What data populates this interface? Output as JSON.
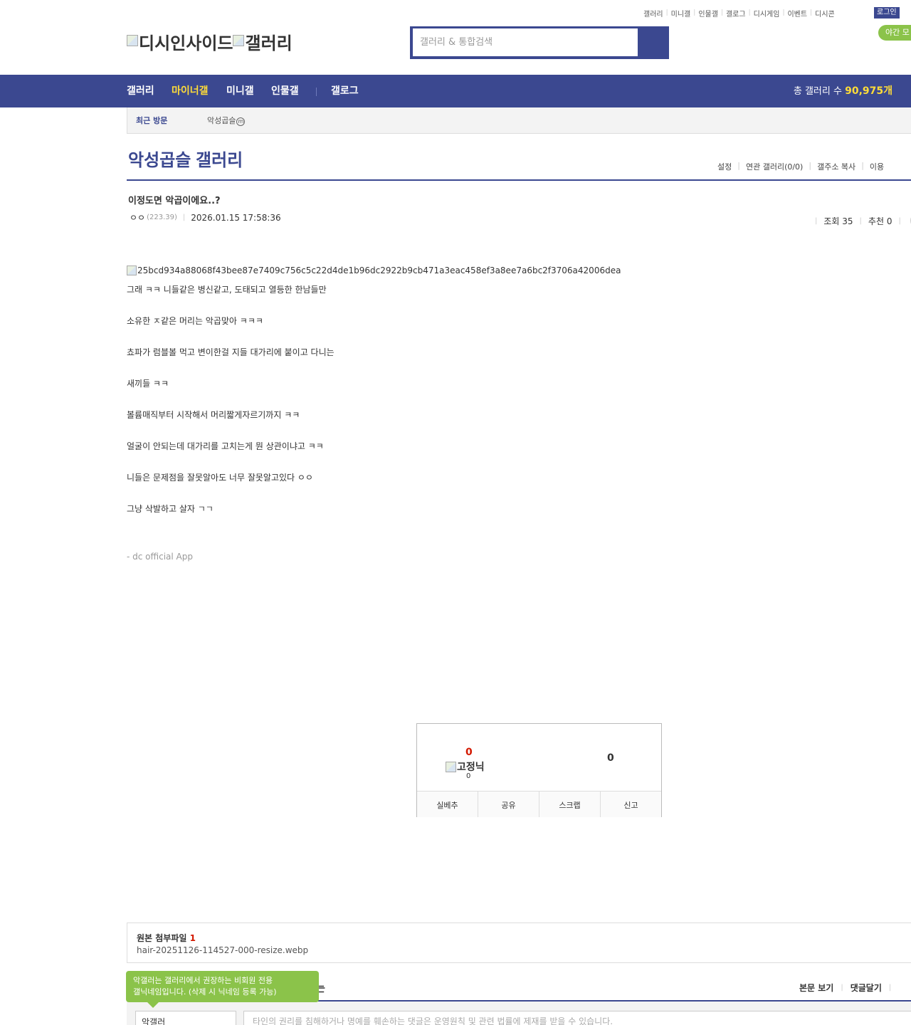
{
  "util_links": [
    "갤러리",
    "미니갤",
    "인물갤",
    "갤로그",
    "디시게임",
    "이벤트",
    "디시콘"
  ],
  "login_label": "로그인",
  "night_mode_label": "야간 모",
  "logo": {
    "site_alt": "디시인사이드",
    "gallery_alt": "갤러리"
  },
  "search": {
    "placeholder": "갤러리 & 통합검색"
  },
  "nav": {
    "items": [
      "갤러리",
      "마이너갤",
      "미니갤",
      "인물갤",
      "갤로그"
    ],
    "active_index": 1,
    "total_label": "총 갤러리 수",
    "total_count": "90,975개"
  },
  "recent": {
    "title": "최근 방문",
    "item": "악성곱슬",
    "item_badge": "m"
  },
  "gallery": {
    "title": "악성곱슬 갤러리",
    "tools": [
      "설정",
      "연관 갤러리(0/0)",
      "갤주소 복사",
      "이용"
    ]
  },
  "post": {
    "title": "이정도면 악곱이에요..?",
    "author": "ㅇㅇ",
    "ip": "(223.39)",
    "date": "2026.01.15 17:58:36",
    "views_label": "조회 35",
    "recommend_label": "추천 0",
    "image_alt": "25bcd934a88068f43bee87e7409c756c5c22d4de1b96dc2922b9cb471a3eac458ef3a8ee7a6bc2f3706a42006dea",
    "lines": [
      "그래 ㅋㅋ 니들같은 병신같고, 도태되고 열등한 한남들만",
      "소유한 ㅈ같은 머리는 악곱맞아 ㅋㅋㅋ",
      "쵸파가 럼블볼 먹고 변이한걸 지들 대가리에 붙이고 다니는",
      "새끼들 ㅋㅋ",
      "볼륨매직부터 시작해서 머리짧게자르기까지 ㅋㅋ",
      "얼굴이 안되는데 대가리를 고치는게 뭔 상관이냐고 ㅋㅋ",
      "니들은 문제점을 잘못알아도 너무 잘못알고있다 ㅇㅇ",
      "그냥 삭발하고 살자 ㄱㄱ"
    ],
    "app_signature": "- dc official App"
  },
  "recommend": {
    "up_count": "0",
    "fixed_nick_alt": "고정닉",
    "fixed_count": "0",
    "down_count": "0",
    "buttons": [
      "실베추",
      "공유",
      "스크랩",
      "신고"
    ]
  },
  "attachments": {
    "title": "원본 첨부파일",
    "count": "1",
    "file": "hair-20251126-114527-000-resize.webp"
  },
  "tooltip": {
    "line1": "악갤러는 갤러리에서 권장하는 비회원 전용",
    "line2": "갤닉네임입니다. (삭제 시 닉네임 등록 가능)"
  },
  "comments": {
    "header_fragment": "는",
    "links": [
      "본문 보기",
      "댓글달기"
    ],
    "nickname_value": "악갤러",
    "input_placeholder": "타인의 권리를 침해하거나 명예를 훼손하는 댓글은 운영원칙 및 관련 법률에 제재를 받을 수 있습니다."
  },
  "colors": {
    "brand": "#3b4890",
    "highlight": "#ffdc38",
    "accent_green": "#8bc34a",
    "alert_red": "#d31900"
  }
}
